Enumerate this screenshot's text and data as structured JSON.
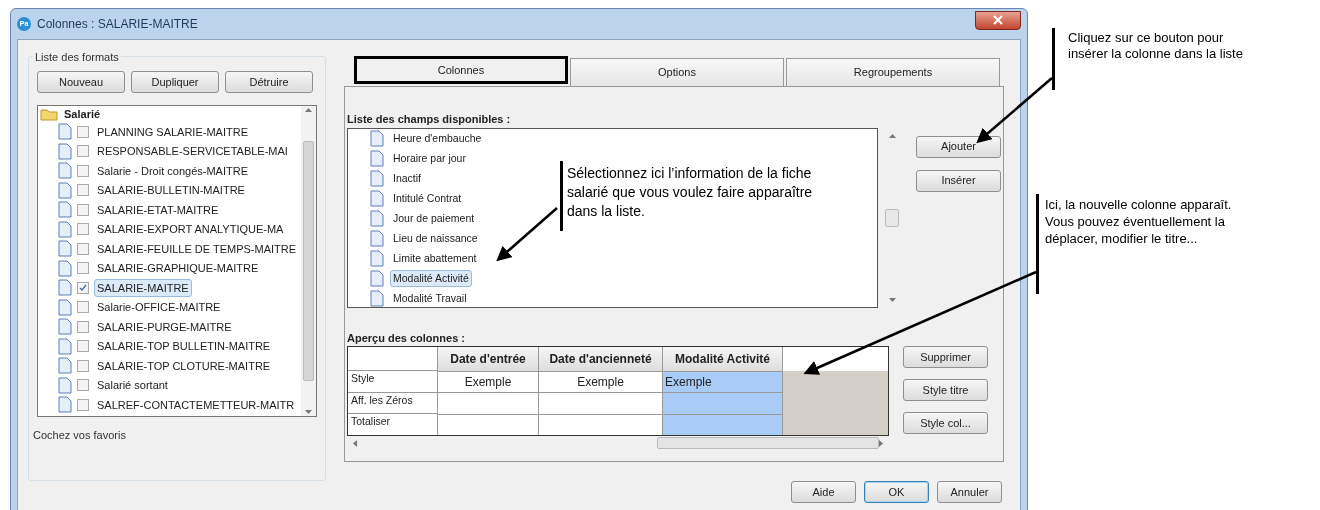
{
  "window": {
    "title": "Colonnes : SALARIE-MAITRE",
    "app_badge": "Pa"
  },
  "formats": {
    "group_label": "Liste des formats",
    "buttons": [
      "Nouveau",
      "Dupliquer",
      "Détruire"
    ],
    "tree": [
      {
        "label": "Salarié",
        "children": [
          {
            "label": "PLANNING SALARIE-MAITRE",
            "checked": false,
            "selected": false
          },
          {
            "label": "RESPONSABLE-SERVICETABLE-MAI",
            "checked": false,
            "selected": false
          },
          {
            "label": "Salarie - Droit congés-MAITRE",
            "checked": false,
            "selected": false
          },
          {
            "label": "SALARIE-BULLETIN-MAITRE",
            "checked": false,
            "selected": false
          },
          {
            "label": "SALARIE-ETAT-MAITRE",
            "checked": false,
            "selected": false
          },
          {
            "label": "SALARIE-EXPORT ANALYTIQUE-MA",
            "checked": false,
            "selected": false
          },
          {
            "label": "SALARIE-FEUILLE DE TEMPS-MAITRE",
            "checked": false,
            "selected": false
          },
          {
            "label": "SALARIE-GRAPHIQUE-MAITRE",
            "checked": false,
            "selected": false
          },
          {
            "label": "SALARIE-MAITRE",
            "checked": true,
            "selected": true
          },
          {
            "label": "Salarie-OFFICE-MAITRE",
            "checked": false,
            "selected": false
          },
          {
            "label": "SALARIE-PURGE-MAITRE",
            "checked": false,
            "selected": false
          },
          {
            "label": "SALARIE-TOP BULLETIN-MAITRE",
            "checked": false,
            "selected": false
          },
          {
            "label": "SALARIE-TOP CLOTURE-MAITRE",
            "checked": false,
            "selected": false
          },
          {
            "label": "Salarié sortant",
            "checked": false,
            "selected": false
          },
          {
            "label": "SALREF-CONTACTEMETTEUR-MAITR",
            "checked": false,
            "selected": false
          }
        ]
      }
    ],
    "hint": "Cochez vos favoris"
  },
  "tabs": [
    {
      "label": "Colonnes",
      "selected": true
    },
    {
      "label": "Options",
      "selected": false
    },
    {
      "label": "Regroupements",
      "selected": false
    }
  ],
  "fields": {
    "label": "Liste des champs disponibles :",
    "items": [
      {
        "label": "Heure d'embauche",
        "selected": false
      },
      {
        "label": "Horaire par jour",
        "selected": false
      },
      {
        "label": "Inactif",
        "selected": false
      },
      {
        "label": "Intitulé Contrat",
        "selected": false
      },
      {
        "label": "Jour de paiement",
        "selected": false
      },
      {
        "label": "Lieu de naissance",
        "selected": false
      },
      {
        "label": "Limite abattement",
        "selected": false
      },
      {
        "label": "Modalité Activité",
        "selected": true
      },
      {
        "label": "Modalité Travail",
        "selected": false
      }
    ],
    "buttons": [
      "Ajouter",
      "Insérer"
    ]
  },
  "preview": {
    "label": "Aperçu des colonnes :",
    "columns": [
      {
        "title": "Date d'entrée",
        "selected": false
      },
      {
        "title": "Date d'ancienneté",
        "selected": false
      },
      {
        "title": "Modalité Activité",
        "selected": true
      }
    ],
    "rows": [
      {
        "label": "Style",
        "cells": [
          "Exemple",
          "Exemple",
          "Exemple"
        ]
      },
      {
        "label": "Aff. les Zéros",
        "cells": []
      },
      {
        "label": "Totaliser",
        "cells": []
      }
    ],
    "buttons": [
      "Supprimer",
      "Style titre",
      "Style col..."
    ]
  },
  "dialog_buttons": [
    {
      "label": "Aide",
      "default": false
    },
    {
      "label": "OK",
      "default": true
    },
    {
      "label": "Annuler",
      "default": false
    }
  ],
  "callouts": [
    "Cliquez sur ce bouton pour insérer la colonne dans la liste",
    "Sélectionnez ici l’information de la fiche salarié que vous voulez faire apparaître dans la liste.",
    "Ici, la nouvelle colonne apparaît. Vous pouvez éventuellement la déplacer, modifier le titre..."
  ]
}
